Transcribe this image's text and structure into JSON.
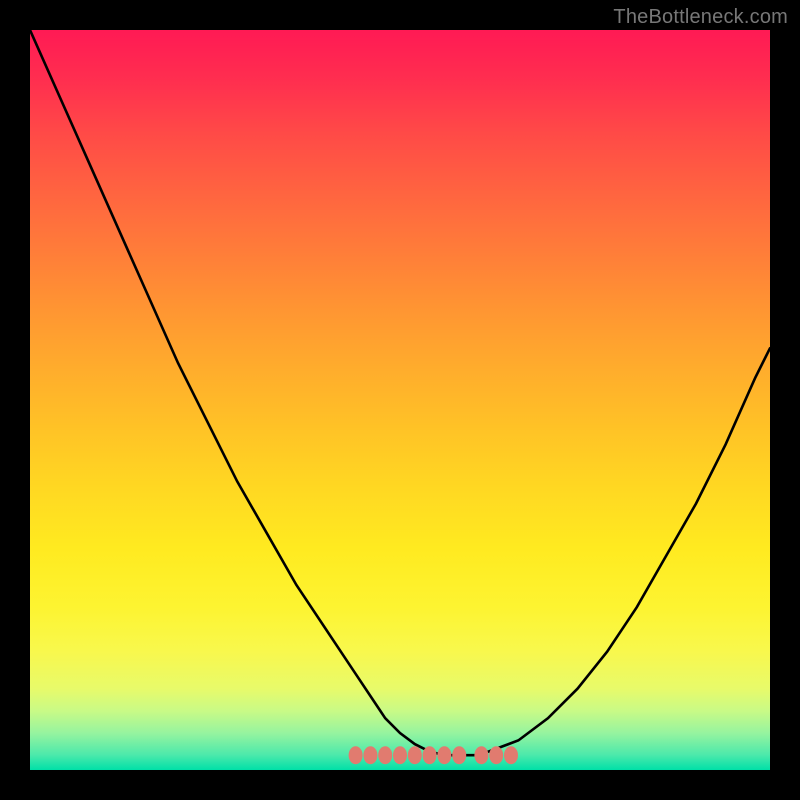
{
  "watermark": "TheBottleneck.com",
  "chart_data": {
    "type": "line",
    "title": "",
    "xlabel": "",
    "ylabel": "",
    "xlim": [
      0,
      100
    ],
    "ylim": [
      0,
      100
    ],
    "series": [
      {
        "name": "curve",
        "x": [
          0,
          4,
          8,
          12,
          16,
          20,
          24,
          28,
          32,
          36,
          40,
          44,
          46,
          48,
          50,
          52,
          54,
          56,
          58,
          60,
          62,
          66,
          70,
          74,
          78,
          82,
          86,
          90,
          94,
          98,
          100
        ],
        "y": [
          100,
          91,
          82,
          73,
          64,
          55,
          47,
          39,
          32,
          25,
          19,
          13,
          10,
          7,
          5,
          3.5,
          2.5,
          2,
          2,
          2,
          2.5,
          4,
          7,
          11,
          16,
          22,
          29,
          36,
          44,
          53,
          57
        ]
      }
    ],
    "bottom_markers_x": [
      44,
      46,
      48,
      50,
      52,
      54,
      56,
      58,
      61,
      63,
      65
    ],
    "gradient_stops": [
      {
        "pos": 0,
        "color": "#ff1a54"
      },
      {
        "pos": 25,
        "color": "#ff723d"
      },
      {
        "pos": 50,
        "color": "#ffbe28"
      },
      {
        "pos": 75,
        "color": "#fdf030"
      },
      {
        "pos": 90,
        "color": "#d8fa7e"
      },
      {
        "pos": 100,
        "color": "#00e0a8"
      }
    ]
  }
}
